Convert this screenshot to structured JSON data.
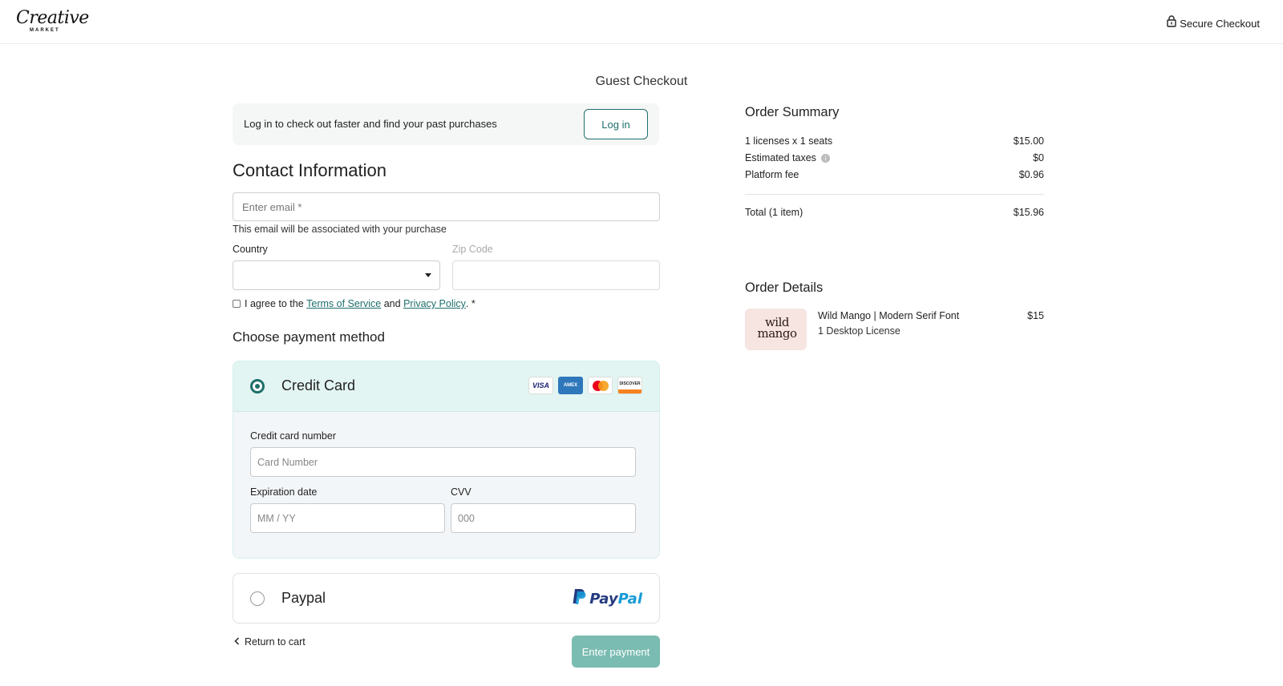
{
  "header": {
    "logo_main": "Creative",
    "logo_sub": "MARKET",
    "secure_label": "Secure Checkout"
  },
  "checkout": {
    "title": "Guest Checkout",
    "login_banner": {
      "text": "Log in to check out faster and find your past purchases",
      "button": "Log in"
    },
    "contact": {
      "heading": "Contact Information",
      "email_placeholder": "Enter email *",
      "email_value": "",
      "email_hint": "This email will be associated with your purchase",
      "country_label": "Country",
      "country_value": "",
      "zip_label": "Zip Code",
      "zip_value": "",
      "agree_prefix": "I agree to the",
      "terms_link": "Terms of Service",
      "agree_and": "and",
      "privacy_link": "Privacy Policy",
      "agree_suffix": ". *"
    },
    "payment": {
      "heading": "Choose payment method",
      "credit_card": {
        "label": "Credit Card",
        "selected": true,
        "card_brands": [
          "VISA",
          "AMEX",
          "mastercard",
          "DISCOVER"
        ],
        "number_label": "Credit card number",
        "number_placeholder": "Card Number",
        "expiry_label": "Expiration date",
        "expiry_placeholder": "MM / YY",
        "cvv_label": "CVV",
        "cvv_placeholder": "000"
      },
      "paypal": {
        "label": "Paypal",
        "selected": false,
        "logo_pay": "Pay",
        "logo_pal": "Pal"
      }
    },
    "return_link": "Return to cart",
    "enter_payment_button": "Enter payment"
  },
  "order_summary": {
    "heading": "Order Summary",
    "rows": [
      {
        "label": "1 licenses x 1 seats",
        "value": "$15.00"
      },
      {
        "label": "Estimated taxes",
        "value": "$0"
      },
      {
        "label": "Platform fee",
        "value": "$0.96"
      }
    ],
    "total_label": "Total (1 item)",
    "total_value": "$15.96"
  },
  "order_details": {
    "heading": "Order Details",
    "item": {
      "thumb_line1": "wild",
      "thumb_line2": "mango",
      "name": "Wild Mango | Modern Serif Font",
      "license": "1 Desktop License",
      "price": "$15"
    }
  },
  "colors": {
    "accent": "#1e6f6b",
    "selected_bg": "#e2f5f2",
    "button_disabled": "#7bbcb2",
    "paypal_dark": "#253b80",
    "paypal_light": "#179bd7"
  }
}
